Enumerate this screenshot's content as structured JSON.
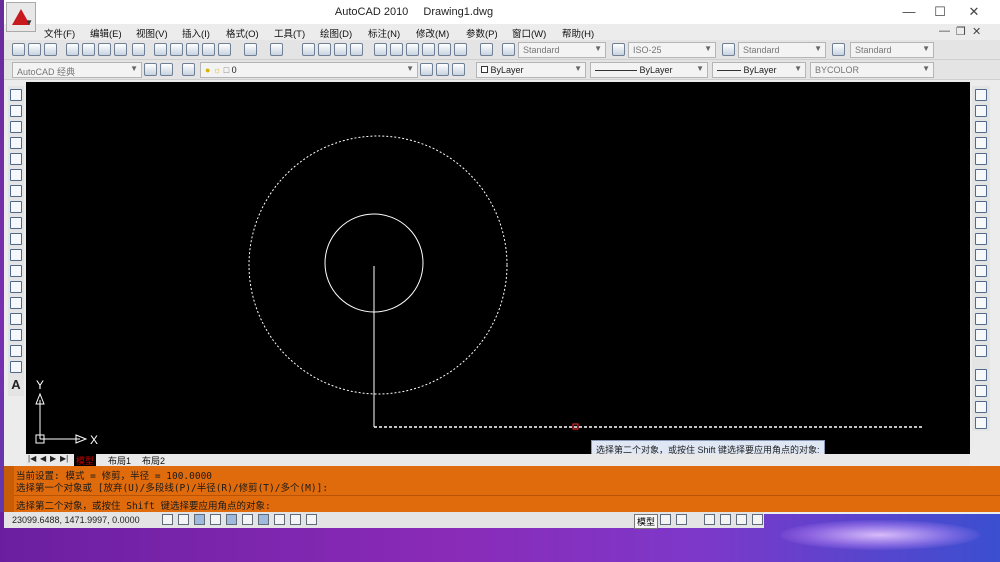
{
  "window": {
    "app_title": "AutoCAD 2010",
    "doc_title": "Drawing1.dwg"
  },
  "menu": [
    "文件(F)",
    "编辑(E)",
    "视图(V)",
    "插入(I)",
    "格式(O)",
    "工具(T)",
    "绘图(D)",
    "标注(N)",
    "修改(M)",
    "参数(P)",
    "窗口(W)",
    "帮助(H)"
  ],
  "toolbar": {
    "text_style": "Standard",
    "dim_style": "ISO-25",
    "table_style": "Standard",
    "mleader_style": "Standard",
    "workspace": "AutoCAD 经典",
    "layer": "0",
    "color": "ByLayer",
    "linetype": "ByLayer",
    "lineweight": "ByLayer",
    "plotstyle": "BYCOLOR"
  },
  "canvas": {
    "ucs_x": "X",
    "ucs_y": "Y",
    "tooltip": "选择第二个对象，或按住 Shift 键选择要应用角点的对象:"
  },
  "tabs": {
    "model": "模型",
    "layout1": "布局1",
    "layout2": "布局2"
  },
  "command": {
    "line1": "当前设置: 模式 = 修剪，半径 = 100.0000",
    "line2": "选择第一个对象或 [放弃(U)/多段线(P)/半径(R)/修剪(T)/多个(M)]:",
    "line3": "选择第二个对象，或按住 Shift 键选择要应用角点的对象:"
  },
  "status": {
    "coordinates": "23099.6488, 1471.9997, 0.0000",
    "model": "模型"
  }
}
